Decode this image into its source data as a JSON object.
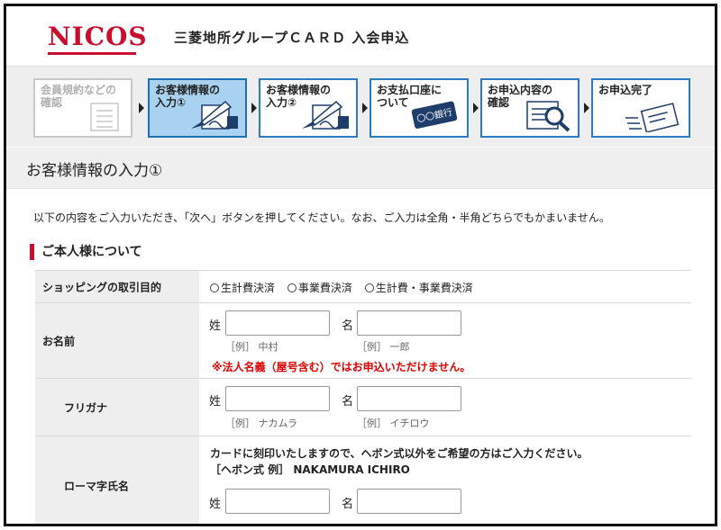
{
  "header": {
    "logo": "NICOS",
    "title": "三菱地所グループＣＡＲＤ 入会申込"
  },
  "steps": [
    {
      "line1": "会員規約などの",
      "line2": "確認",
      "state": "done"
    },
    {
      "line1": "お客様情報の",
      "line2": "入力①",
      "state": "active"
    },
    {
      "line1": "お客様情報の",
      "line2": "入力②",
      "state": "todo"
    },
    {
      "line1": "お支払口座に",
      "line2": "ついて",
      "state": "todo",
      "badge": "〇〇銀行"
    },
    {
      "line1": "お申込内容の",
      "line2": "確認",
      "state": "todo"
    },
    {
      "line1": "お申込完了",
      "line2": "",
      "state": "todo"
    }
  ],
  "page_title": "お客様情報の入力①",
  "intro": "以下の内容をご入力いただき、「次へ」ボタンを押してください。なお、ご入力は全角・半角どちらでもかまいません。",
  "section_title": "ご本人様について",
  "form": {
    "purpose": {
      "label": "ショッピングの取引目的",
      "options": [
        "生計費決済",
        "事業費決済",
        "生計費・事業費決済"
      ]
    },
    "name": {
      "label": "お名前",
      "sei_label": "姓",
      "mei_label": "名",
      "sei_value": "",
      "mei_value": "",
      "sei_example": "［例］ 中村",
      "mei_example": "［例］ 一郎",
      "warning": "※法人名義（屋号含む）ではお申込いただけません。"
    },
    "furigana": {
      "label": "フリガナ",
      "sei_label": "姓",
      "mei_label": "名",
      "sei_value": "",
      "mei_value": "",
      "sei_example": "［例］ ナカムラ",
      "mei_example": "［例］ イチロウ"
    },
    "roman": {
      "label": "ローマ字氏名",
      "note1": "カードに刻印いたしますので、ヘボン式以外をご希望の方はご入力ください。",
      "note2": "［ヘボン式 例］ NAKAMURA ICHIRO",
      "sei_label": "姓",
      "mei_label": "名",
      "sei_value": "",
      "mei_value": ""
    }
  },
  "colors": {
    "brand": "#c8102e",
    "active_step": "#a9d1f0",
    "step_border": "#2a7bc5",
    "warning": "#e00000"
  }
}
